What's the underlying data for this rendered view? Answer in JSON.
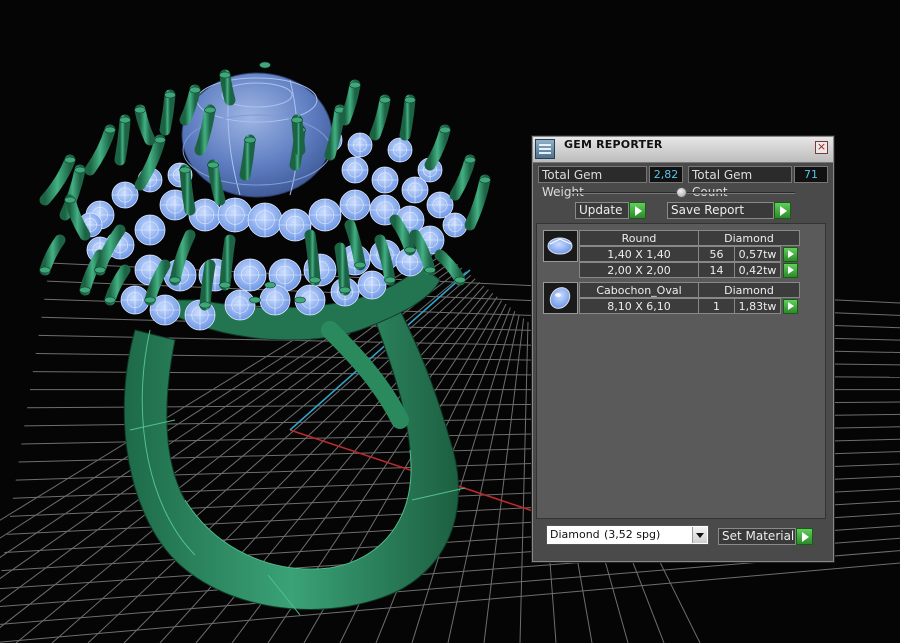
{
  "panel": {
    "title": "GEM REPORTER",
    "close_icon": "close-icon",
    "app_icon": "gem-reporter-app-icon"
  },
  "stats": {
    "total_weight_label": "Total Gem Weight",
    "total_weight_value": "2,82",
    "total_count_label": "Total Gem Count",
    "total_count_value": "71"
  },
  "actions": {
    "update_label": "Update",
    "save_report_label": "Save Report"
  },
  "gems": [
    {
      "icon": "round-gem-icon",
      "shape": "Round",
      "material": "Diamond",
      "rows": [
        {
          "size": "1,40 X 1,40",
          "count": "56",
          "weight": "0,57tw"
        },
        {
          "size": "2,00 X 2,00",
          "count": "14",
          "weight": "0,42tw"
        }
      ]
    },
    {
      "icon": "oval-cabochon-gem-icon",
      "shape": "Cabochon_Oval",
      "material": "Diamond",
      "rows": [
        {
          "size": "8,10 X 6,10",
          "count": "1",
          "weight": "1,83tw"
        }
      ]
    }
  ],
  "material": {
    "selected_name": "Diamond",
    "selected_sg": "(3,52 spg)",
    "set_label": "Set Material"
  },
  "colors": {
    "viewport_bg": "#050505",
    "grid_line": "#7a7a7a",
    "model_green": "#2e8b62",
    "gem_blue": "#86aee8",
    "axis_x": "#c0282a",
    "axis_z": "#2fa3c8",
    "value_cyan": "#57c6e8",
    "go_button_green": "#3fae3a"
  }
}
